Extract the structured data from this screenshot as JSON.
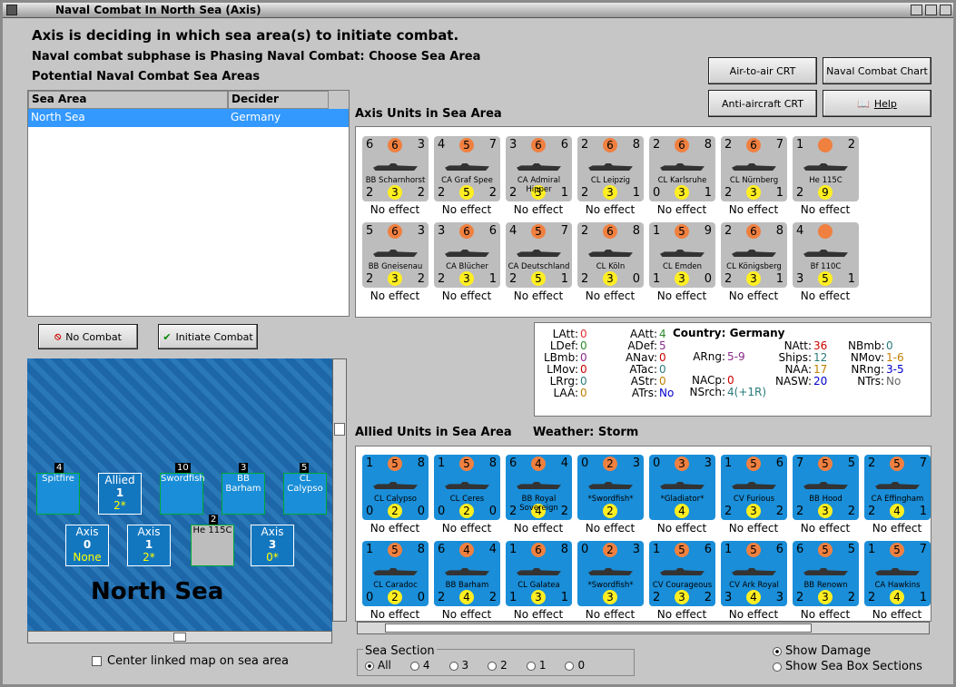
{
  "window": {
    "title": "Naval Combat In North Sea (Axis)"
  },
  "header": {
    "line1": "Axis is deciding in which sea area(s) to initiate combat.",
    "line2": "Naval combat subphase is Phasing Naval Combat: Choose Sea Area",
    "line3": "Potential Naval Combat Sea Areas"
  },
  "buttons": {
    "air_crt": "Air-to-air CRT",
    "naval_chart": "Naval Combat Chart",
    "aa_crt": "Anti-aircraft CRT",
    "help": "Help",
    "no_combat": "No Combat",
    "initiate": "Initiate Combat"
  },
  "sea_table": {
    "headers": [
      "Sea Area",
      "Decider"
    ],
    "rows": [
      [
        "North Sea",
        "Germany"
      ]
    ]
  },
  "axis_label": "Axis Units in Sea Area",
  "allied_label": "Allied Units in Sea Area",
  "weather_label": "Weather:  Storm",
  "effect": "No effect",
  "axis_units": [
    {
      "name": "BB Scharnhorst",
      "tl": "6",
      "tc": "6",
      "tr": "3",
      "bl": "2",
      "bc": "3",
      "br": "2"
    },
    {
      "name": "CA Graf Spee",
      "tl": "4",
      "tc": "5",
      "tr": "7",
      "bl": "2",
      "bc": "5",
      "br": "2"
    },
    {
      "name": "CA Admiral Hipper",
      "tl": "3",
      "tc": "6",
      "tr": "6",
      "bl": "2",
      "bc": "3",
      "br": "1"
    },
    {
      "name": "CL Leipzig",
      "tl": "2",
      "tc": "6",
      "tr": "8",
      "bl": "2",
      "bc": "3",
      "br": "1"
    },
    {
      "name": "CL Karlsruhe",
      "tl": "2",
      "tc": "6",
      "tr": "8",
      "bl": "0",
      "bc": "3",
      "br": "1"
    },
    {
      "name": "CL Nürnberg",
      "tl": "2",
      "tc": "6",
      "tr": "7",
      "bl": "2",
      "bc": "3",
      "br": "1"
    },
    {
      "name": "He 115C",
      "tl": "1",
      "tc": "",
      "tr": "2",
      "bl": "2",
      "bc": "9",
      "br": ""
    },
    {
      "name": "BB Gneisenau",
      "tl": "5",
      "tc": "6",
      "tr": "3",
      "bl": "2",
      "bc": "3",
      "br": "2"
    },
    {
      "name": "CA Blücher",
      "tl": "3",
      "tc": "6",
      "tr": "6",
      "bl": "2",
      "bc": "3",
      "br": "1"
    },
    {
      "name": "CA Deutschland",
      "tl": "4",
      "tc": "5",
      "tr": "7",
      "bl": "2",
      "bc": "5",
      "br": "1"
    },
    {
      "name": "CL Köln",
      "tl": "2",
      "tc": "6",
      "tr": "8",
      "bl": "2",
      "bc": "3",
      "br": "0"
    },
    {
      "name": "CL Emden",
      "tl": "1",
      "tc": "5",
      "tr": "9",
      "bl": "1",
      "bc": "3",
      "br": "0"
    },
    {
      "name": "CL Königsberg",
      "tl": "2",
      "tc": "6",
      "tr": "8",
      "bl": "2",
      "bc": "3",
      "br": "1"
    },
    {
      "name": "Bf 110C",
      "tl": "4",
      "tc": "",
      "tr": "",
      "bl": "3",
      "bc": "5",
      "br": "1"
    }
  ],
  "allied_units": [
    {
      "name": "CL Calypso",
      "tl": "1",
      "tc": "5",
      "tr": "8",
      "bl": "0",
      "bc": "2",
      "br": "0"
    },
    {
      "name": "CL Ceres",
      "tl": "1",
      "tc": "5",
      "tr": "8",
      "bl": "0",
      "bc": "2",
      "br": "0"
    },
    {
      "name": "BB Royal Sovereign",
      "tl": "6",
      "tc": "4",
      "tr": "4",
      "bl": "2",
      "bc": "4",
      "br": "2"
    },
    {
      "name": "*Swordfish*",
      "tl": "0",
      "tc": "2",
      "tr": "3",
      "bl": "",
      "bc": "2",
      "br": ""
    },
    {
      "name": "*Gladiator*",
      "tl": "0",
      "tc": "3",
      "tr": "3",
      "bl": "",
      "bc": "4",
      "br": ""
    },
    {
      "name": "CV Furious",
      "tl": "1",
      "tc": "5",
      "tr": "6",
      "bl": "2",
      "bc": "3",
      "br": "2"
    },
    {
      "name": "BB Hood",
      "tl": "7",
      "tc": "5",
      "tr": "5",
      "bl": "2",
      "bc": "3",
      "br": "2"
    },
    {
      "name": "CA Effingham",
      "tl": "2",
      "tc": "5",
      "tr": "7",
      "bl": "2",
      "bc": "4",
      "br": "1"
    },
    {
      "name": "CL Caradoc",
      "tl": "1",
      "tc": "5",
      "tr": "8",
      "bl": "0",
      "bc": "2",
      "br": "0"
    },
    {
      "name": "BB Barham",
      "tl": "6",
      "tc": "4",
      "tr": "4",
      "bl": "2",
      "bc": "4",
      "br": "2"
    },
    {
      "name": "CL Galatea",
      "tl": "1",
      "tc": "6",
      "tr": "8",
      "bl": "1",
      "bc": "3",
      "br": "1"
    },
    {
      "name": "*Swordfish*",
      "tl": "0",
      "tc": "2",
      "tr": "3",
      "bl": "",
      "bc": "3",
      "br": ""
    },
    {
      "name": "CV Courageous",
      "tl": "1",
      "tc": "5",
      "tr": "6",
      "bl": "2",
      "bc": "3",
      "br": "2"
    },
    {
      "name": "CV Ark Royal",
      "tl": "1",
      "tc": "5",
      "tr": "6",
      "bl": "3",
      "bc": "4",
      "br": "3"
    },
    {
      "name": "BB Renown",
      "tl": "6",
      "tc": "5",
      "tr": "5",
      "bl": "2",
      "bc": "3",
      "br": "2"
    },
    {
      "name": "CA Hawkins",
      "tl": "1",
      "tc": "5",
      "tr": "7",
      "bl": "2",
      "bc": "4",
      "br": "1"
    }
  ],
  "stats": {
    "country": "Country: Germany",
    "col1": [
      [
        "LAtt:",
        "0"
      ],
      [
        "LDef:",
        "0"
      ],
      [
        "LBmb:",
        "0"
      ],
      [
        "LMov:",
        "0"
      ],
      [
        "LRrg:",
        "0"
      ],
      [
        "LAA:",
        "0"
      ]
    ],
    "col2": [
      [
        "AAtt:",
        "4"
      ],
      [
        "ADef:",
        "5"
      ],
      [
        "ANav:",
        "0"
      ],
      [
        "ATac:",
        "0"
      ],
      [
        "AStr:",
        "0"
      ],
      [
        "ATrs:",
        "No"
      ]
    ],
    "col3": [
      [
        "ARng:",
        "5-9"
      ],
      [
        "NACp:",
        "0"
      ],
      [
        "NSrch:",
        "4(+1R)"
      ]
    ],
    "col4": [
      [
        "NAtt:",
        "36"
      ],
      [
        "Ships:",
        "12"
      ],
      [
        "NAA:",
        "17"
      ],
      [
        "NASW:",
        "20"
      ]
    ],
    "col5": [
      [
        "NBmb:",
        "0"
      ],
      [
        "NMov:",
        "1-6"
      ],
      [
        "NRng:",
        "3-5"
      ],
      [
        "NTrs:",
        "No"
      ]
    ]
  },
  "map": {
    "title": "North Sea",
    "boxes": [
      {
        "label": "Allied",
        "a": "1",
        "b": "2*"
      },
      {
        "label": "Axis",
        "a": "0",
        "b": "None"
      },
      {
        "label": "Axis",
        "a": "1",
        "b": "2*"
      },
      {
        "label": "Axis",
        "a": "3",
        "b": "0*"
      }
    ],
    "stacks": [
      {
        "label": "Spitfire",
        "num": "4"
      },
      {
        "label": "Swordfish",
        "num": "10"
      },
      {
        "label": "BB Barham",
        "num": "3"
      },
      {
        "label": "CL Calypso",
        "num": "5"
      },
      {
        "label": "He 115C",
        "num": "2"
      }
    ]
  },
  "center_map": "Center linked map on sea area",
  "sea_section": {
    "title": "Sea Section",
    "options": [
      "All",
      "4",
      "3",
      "2",
      "1",
      "0"
    ]
  },
  "show": {
    "damage": "Show Damage",
    "boxes": "Show Sea Box Sections"
  }
}
